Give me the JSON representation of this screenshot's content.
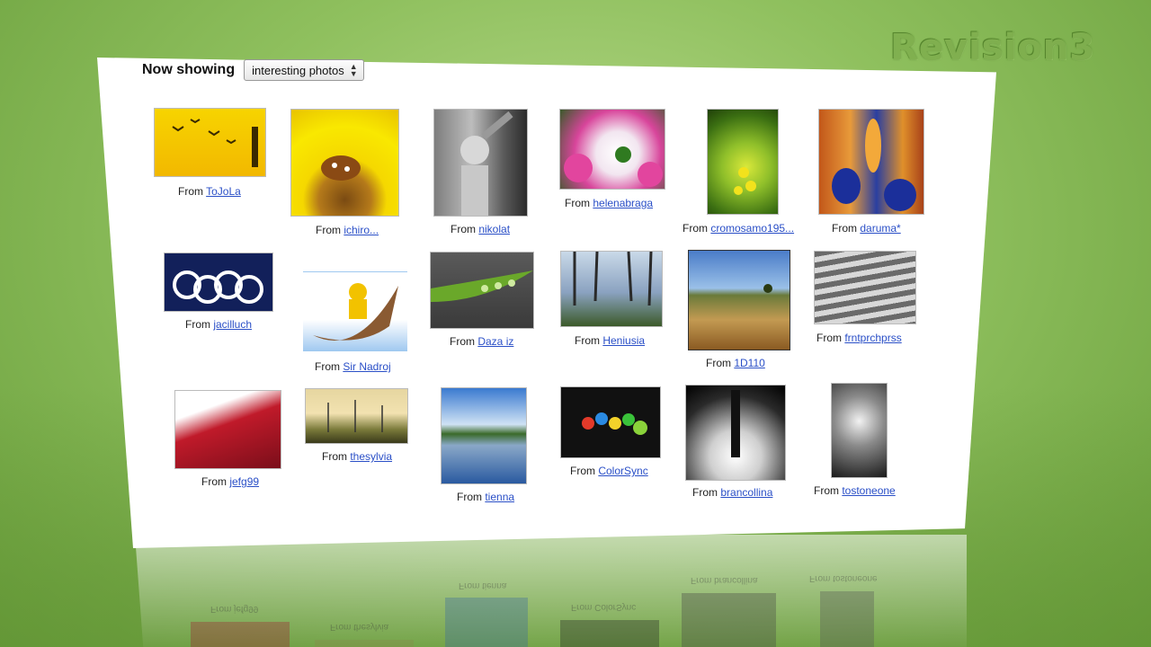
{
  "brand": {
    "logo_text": "Revision3"
  },
  "filter": {
    "label": "Now showing",
    "selected": "interesting photos"
  },
  "from_prefix": "From",
  "photos": [
    {
      "author": "ToJoLa"
    },
    {
      "author": "ichiro..."
    },
    {
      "author": "nikolat"
    },
    {
      "author": "helenabraga"
    },
    {
      "author": "cromosamo195..."
    },
    {
      "author": "daruma*"
    },
    {
      "author": "jacilluch"
    },
    {
      "author": "Sir Nadroj"
    },
    {
      "author": "Daza iz"
    },
    {
      "author": "Heniusia"
    },
    {
      "author": "1D110"
    },
    {
      "author": "frntprchprss"
    },
    {
      "author": "jefg99"
    },
    {
      "author": "thesylvia"
    },
    {
      "author": "tienna"
    },
    {
      "author": "ColorSync"
    },
    {
      "author": "brancollina"
    },
    {
      "author": "tostoneone"
    }
  ],
  "reflection_captions": [
    "From jefg99",
    "From thesylvia",
    "From tienna",
    "From ColorSync",
    "From brancollina",
    "From tostoneone"
  ]
}
